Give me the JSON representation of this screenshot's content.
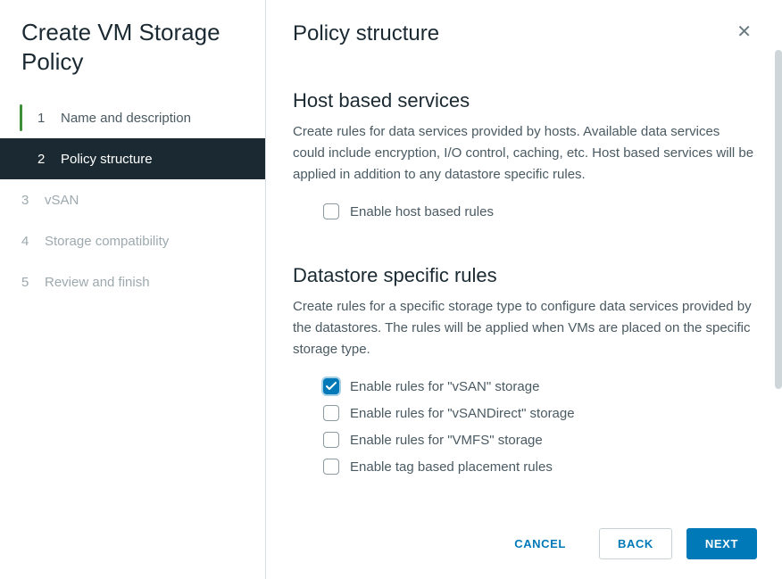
{
  "wizard": {
    "title": "Create VM Storage Policy",
    "steps": [
      {
        "num": "1",
        "label": "Name and description",
        "state": "completed"
      },
      {
        "num": "2",
        "label": "Policy structure",
        "state": "active"
      },
      {
        "num": "3",
        "label": "vSAN",
        "state": "disabled"
      },
      {
        "num": "4",
        "label": "Storage compatibility",
        "state": "disabled"
      },
      {
        "num": "5",
        "label": "Review and finish",
        "state": "disabled"
      }
    ]
  },
  "page": {
    "title": "Policy structure",
    "close_aria": "Close"
  },
  "host_section": {
    "title": "Host based services",
    "desc": "Create rules for data services provided by hosts. Available data services could include encryption, I/O control, caching, etc. Host based services will be applied in addition to any datastore specific rules.",
    "checkbox_label": "Enable host based rules",
    "checked": false
  },
  "datastore_section": {
    "title": "Datastore specific rules",
    "desc": "Create rules for a specific storage type to configure data services provided by the datastores. The rules will be applied when VMs are placed on the specific storage type.",
    "options": [
      {
        "label": "Enable rules for \"vSAN\" storage",
        "checked": true
      },
      {
        "label": "Enable rules for \"vSANDirect\" storage",
        "checked": false
      },
      {
        "label": "Enable rules for \"VMFS\" storage",
        "checked": false
      },
      {
        "label": "Enable tag based placement rules",
        "checked": false
      }
    ]
  },
  "footer": {
    "cancel": "CANCEL",
    "back": "BACK",
    "next": "NEXT"
  }
}
